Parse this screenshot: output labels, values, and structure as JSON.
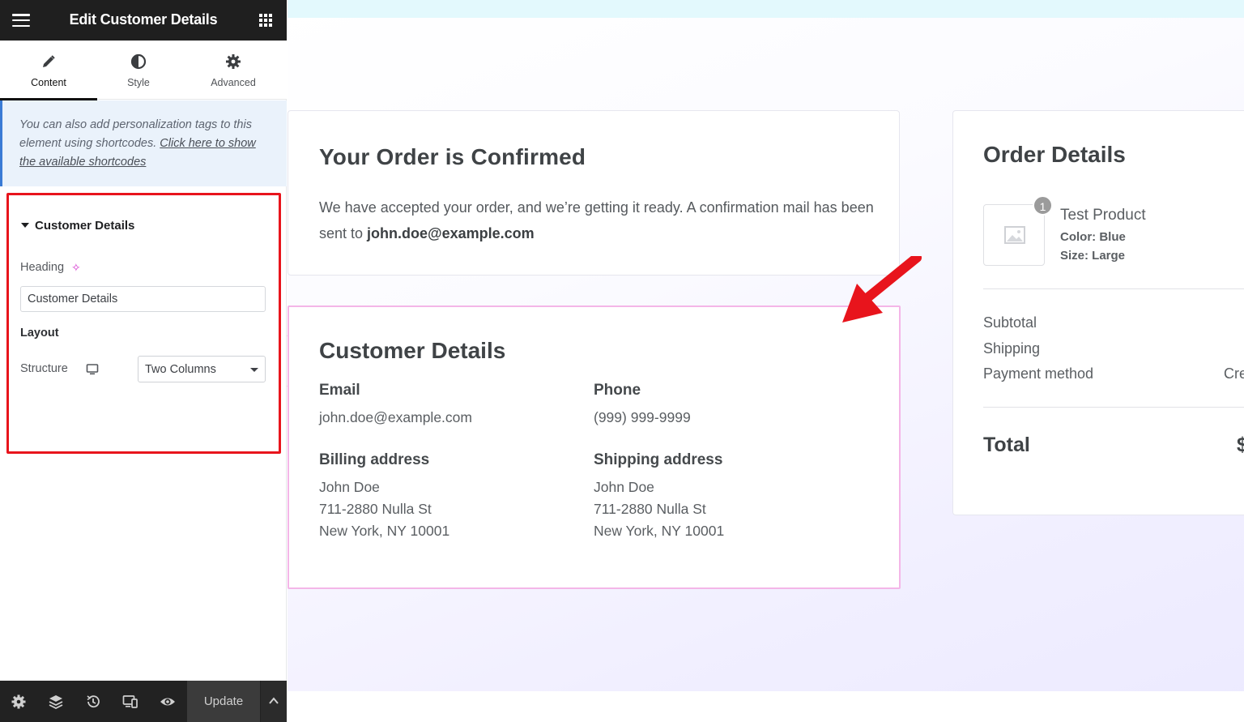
{
  "panel": {
    "title": "Edit Customer Details",
    "tabs": [
      {
        "label": "Content",
        "icon": "pencil-icon",
        "active": true
      },
      {
        "label": "Style",
        "icon": "half-circle-icon",
        "active": false
      },
      {
        "label": "Advanced",
        "icon": "gear-icon",
        "active": false
      }
    ],
    "notice": {
      "text": "You can also add personalization tags to this element using shortcodes. ",
      "link": "Click here to show the available shortcodes"
    },
    "section": {
      "title": "Customer Details",
      "heading_label": "Heading",
      "heading_value": "Customer Details",
      "layout_label": "Layout",
      "structure_label": "Structure",
      "structure_value": "Two Columns"
    },
    "footer": {
      "update_label": "Update",
      "icons": [
        "settings-icon",
        "layers-icon",
        "history-icon",
        "responsive-icon",
        "preview-eye-icon"
      ]
    }
  },
  "canvas": {
    "confirm": {
      "title": "Your Order is Confirmed",
      "text": "We have accepted your order, and we’re getting it ready. A confirmation mail has been sent to ",
      "email": "john.doe@example.com"
    },
    "customer": {
      "title": "Customer Details",
      "email_label": "Email",
      "email_value": "john.doe@example.com",
      "phone_label": "Phone",
      "phone_value": "(999) 999-9999",
      "billing_label": "Billing address",
      "billing_lines": [
        "John Doe",
        "711-2880 Nulla St",
        "New York, NY 10001"
      ],
      "shipping_label": "Shipping address",
      "shipping_lines": [
        "John Doe",
        "711-2880 Nulla St",
        "New York, NY 10001"
      ]
    },
    "order": {
      "title": "Order Details",
      "qty": "1",
      "product_name": "Test Product",
      "color": "Color: Blue",
      "size": "Size: Large",
      "subtotal_label": "Subtotal",
      "shipping_label": "Shipping",
      "payment_label": "Payment method",
      "payment_value_partial": "Cre",
      "total_label": "Total",
      "total_value_partial": "$"
    }
  },
  "colors": {
    "highlight_box": "#e8141c",
    "arrow": "#e8141c",
    "selected_outline": "#f4b6e8",
    "panel_header": "#1f1f1f",
    "notice_border": "#3a7bd5"
  }
}
